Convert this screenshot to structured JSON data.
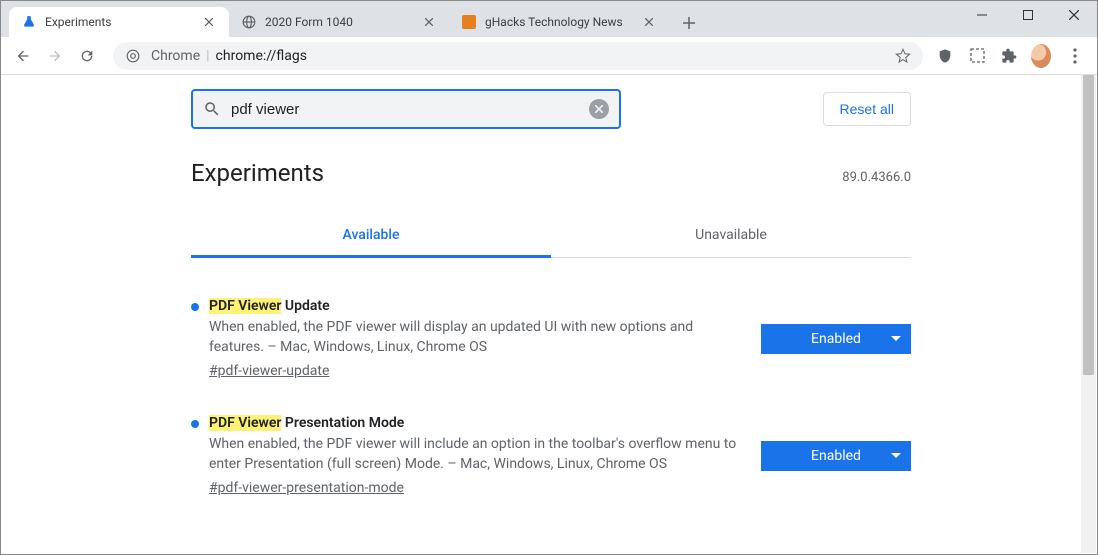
{
  "window": {
    "tabs": [
      {
        "title": "Experiments",
        "active": true
      },
      {
        "title": "2020 Form 1040",
        "active": false
      },
      {
        "title": "gHacks Technology News",
        "active": false
      }
    ]
  },
  "omnibox": {
    "prefix": "Chrome",
    "path": "chrome://flags"
  },
  "search": {
    "value": "pdf viewer",
    "reset_label": "Reset all"
  },
  "header": {
    "title": "Experiments",
    "version": "89.0.4366.0"
  },
  "tabnav": {
    "available": "Available",
    "unavailable": "Unavailable"
  },
  "flags": [
    {
      "title_pre": "PDF Viewer",
      "title_post": " Update",
      "desc": "When enabled, the PDF viewer will display an updated UI with new options and features. – Mac, Windows, Linux, Chrome OS",
      "id": "#pdf-viewer-update",
      "state": "Enabled"
    },
    {
      "title_pre": "PDF Viewer",
      "title_post": " Presentation Mode",
      "desc": "When enabled, the PDF viewer will include an option in the toolbar's overflow menu to enter Presentation (full screen) Mode. – Mac, Windows, Linux, Chrome OS",
      "id": "#pdf-viewer-presentation-mode",
      "state": "Enabled"
    }
  ]
}
